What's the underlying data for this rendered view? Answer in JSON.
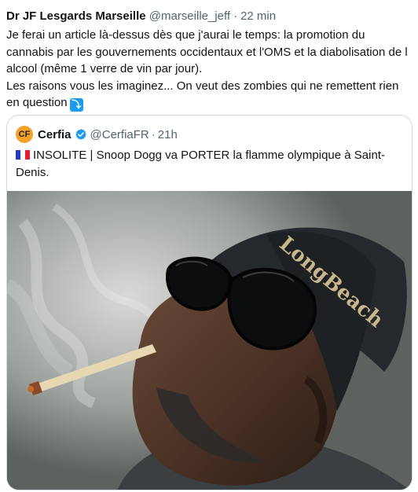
{
  "tweet": {
    "author_name": "Dr JF Lesgards Marseille",
    "handle": "@marseille_jeff",
    "separator": "·",
    "time": "22 min",
    "text_line1": "Je ferai un article là-dessus dès que j'aurai le temps: la promotion du cannabis par les gouvernements occidentaux et l'OMS et la diabolisation de l alcool (même 1 verre de vin par jour).",
    "text_line2": "Les raisons vous les imaginez... On veut des zombies qui ne remettent rien en question",
    "emoji": "⤵"
  },
  "quote": {
    "avatar_text": "CF",
    "name": "Cerfia",
    "handle": "@CerfiaFR",
    "separator": "·",
    "time": "21h",
    "text": "INSOLITE | Snoop Dogg va PORTER la flamme olympique à Saint-Denis.",
    "verified_icon": "verified-badge-icon",
    "flag_icon": "france-flag-icon",
    "image_alt_icon": "photo-smoking-man-in-beanie-and-sunglasses",
    "beanie_text": "LongBeach"
  },
  "colors": {
    "text": "#0f1419",
    "secondary": "#536471",
    "border": "#cfd9de",
    "verified": "#1d9bf0"
  }
}
